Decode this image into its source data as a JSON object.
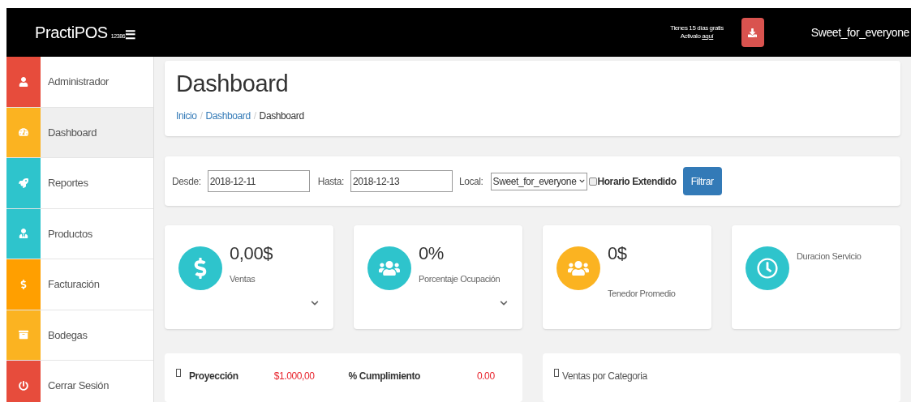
{
  "header": {
    "brand": "PractiPOS",
    "brand_code": "12386",
    "menu_glyph": "☰",
    "trial_text": "Tienes 15 días gratis",
    "activate_text": "Activalo",
    "activate_link": "aquí",
    "user": "Sweet_for_everyone"
  },
  "sidebar": {
    "items": [
      {
        "label": "Administrador",
        "kind": "user",
        "color": "#e74c3c",
        "selected": false
      },
      {
        "label": "Dashboard",
        "kind": "gauge",
        "color": "#fbb321",
        "selected": true
      },
      {
        "label": "Reportes",
        "kind": "rocket",
        "color": "#2ec4cc",
        "selected": false
      },
      {
        "label": "Productos",
        "kind": "person",
        "color": "#2ec4cc",
        "selected": false
      },
      {
        "label": "Facturación",
        "kind": "dollar",
        "color": "#ff9f00",
        "selected": false
      },
      {
        "label": "Bodegas",
        "kind": "box",
        "color": "#fbb321",
        "selected": false
      },
      {
        "label": "Cerrar Sesión",
        "kind": "power",
        "color": "#e74c3c",
        "selected": false
      }
    ]
  },
  "page": {
    "title": "Dashboard",
    "breadcrumb": [
      {
        "label": "Inicio",
        "link": true
      },
      {
        "label": "Dashboard",
        "link": true
      },
      {
        "label": "Dashboard",
        "link": false
      }
    ],
    "breadcrumb_separators": [
      "/",
      "/"
    ]
  },
  "filter": {
    "from_label": "Desde:",
    "from_value": "2018-12-11",
    "to_label": "Hasta:",
    "to_value": "2018-12-13",
    "local_label": "Local:",
    "local_value": "Sweet_for_everyone",
    "extended": {
      "label": "Horario Extendido",
      "checked": false
    },
    "button": "Filtrar"
  },
  "cards": [
    {
      "value": "0,00$",
      "label": "Ventas",
      "kind": "dollar",
      "color": "#2ec4cc",
      "expandable": true
    },
    {
      "value": "0%",
      "label": "Porcentaje Ocupación",
      "kind": "users",
      "color": "#2ec4cc",
      "expandable": true
    },
    {
      "value": "0$",
      "label": "Tenedor Promedio",
      "kind": "users",
      "color": "#fbb321",
      "expandable": false
    },
    {
      "label": "Duracion Servicio",
      "kind": "clock",
      "color": "#2ec4cc",
      "expandable": false
    }
  ],
  "projection": {
    "label": "Proyección",
    "value": "$1.000,00",
    "compliance_label": "% Cumplimiento",
    "compliance_value": "0.00"
  },
  "category_panel": {
    "title": "Ventas por Categoria"
  }
}
